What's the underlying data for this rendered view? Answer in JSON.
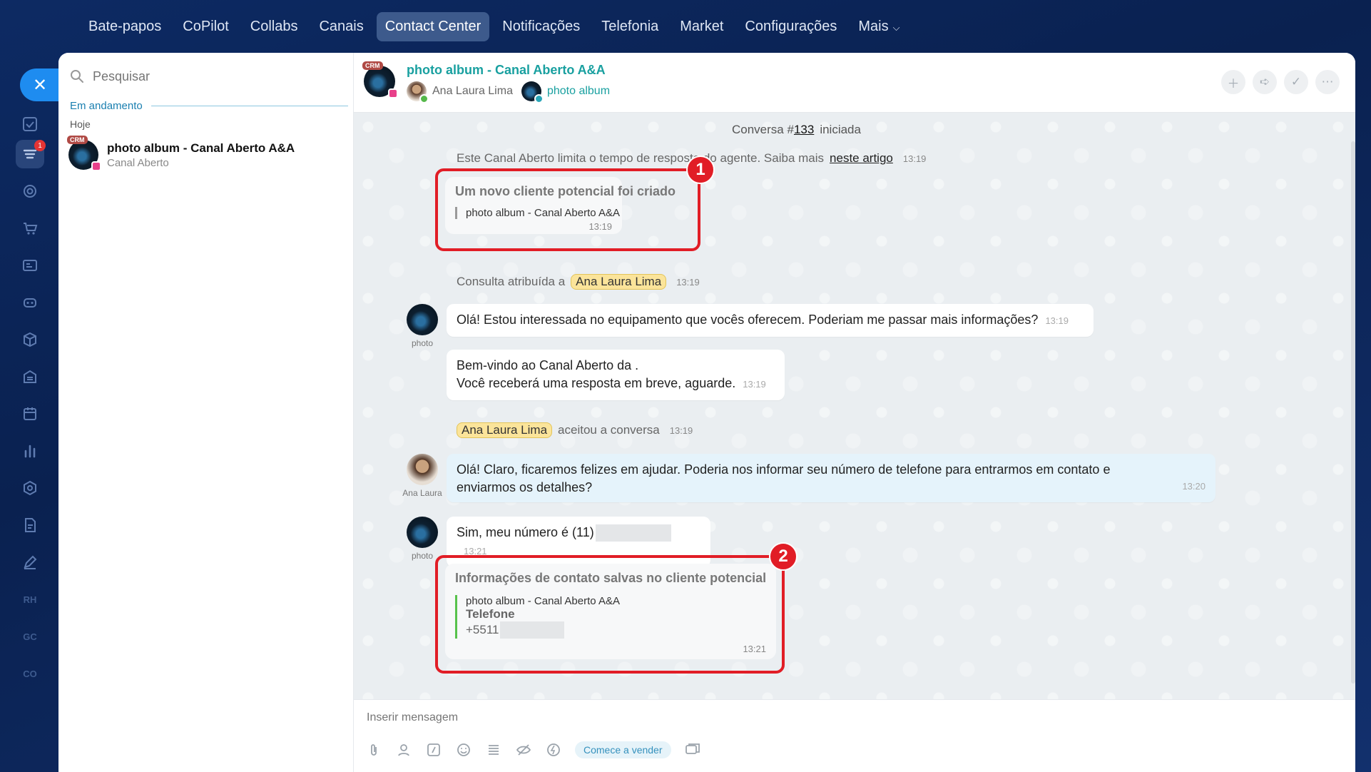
{
  "topnav": {
    "items": [
      "Bate-papos",
      "CoPilot",
      "Collabs",
      "Canais",
      "Contact Center",
      "Notificações",
      "Telefonia",
      "Market",
      "Configurações",
      "Mais"
    ],
    "active_index": 4
  },
  "rail": {
    "close_glyph": "✕",
    "badge": "1",
    "text_items": [
      "RH",
      "GC",
      "CO"
    ]
  },
  "sidebar": {
    "search_placeholder": "Pesquisar",
    "section_title": "Em andamento",
    "day_label": "Hoje",
    "chat": {
      "title": "photo album - Canal Aberto A&A",
      "subtitle": "Canal Aberto",
      "crm_tag": "CRM"
    }
  },
  "header": {
    "title": "photo album - Canal Aberto A&A",
    "crm_tag": "CRM",
    "user_name": "Ana Laura Lima",
    "channel_name": "photo album",
    "actions": [
      "add-icon",
      "forward-icon",
      "check-circle-icon",
      "more-icon"
    ]
  },
  "messages": {
    "conversation_start_prefix": "Conversa #",
    "conversation_number": "133",
    "conversation_start_suffix": "iniciada",
    "limit_notice_text": "Este Canal Aberto limita o tempo de resposta do agente. Saiba mais",
    "limit_notice_link": "neste artigo",
    "limit_notice_time": "13:19",
    "lead_card": {
      "title": "Um novo cliente potencial foi criado",
      "quote": "photo album - Canal Aberto A&A",
      "time": "13:19"
    },
    "assigned_text": "Consulta atribuída a",
    "assigned_name": "Ana Laura Lima",
    "assigned_time": "13:19",
    "client_msg_1": {
      "sender": "photo",
      "text": "Olá! Estou interessada no equipamento que vocês oferecem. Poderiam me passar mais informações?",
      "time": "13:19"
    },
    "welcome_msg": {
      "line1": "Bem-vindo ao Canal Aberto da .",
      "line2": "Você receberá uma resposta em breve, aguarde.",
      "time": "13:19"
    },
    "accepted_name": "Ana Laura Lima",
    "accepted_text": "aceitou a conversa",
    "accepted_time": "13:19",
    "operator_msg": {
      "sender": "Ana Laura",
      "text": "Olá! Claro, ficaremos felizes em ajudar. Poderia nos informar seu número de telefone para entrarmos em contato e enviarmos os detalhes?",
      "time": "13:20"
    },
    "client_msg_2": {
      "sender": "photo",
      "text": "Sim, meu número é (11)",
      "time": "13:21"
    },
    "contact_card": {
      "title": "Informações de contato salvas no cliente potencial",
      "quote_title": "photo album - Canal Aberto A&A",
      "field_label": "Telefone",
      "field_value": "+5511",
      "time": "13:21"
    },
    "callouts": [
      "1",
      "2"
    ]
  },
  "composer": {
    "placeholder": "Inserir mensagem",
    "sell_button": "Comece a vender",
    "tools": [
      "attach-icon",
      "contact-icon",
      "command-icon",
      "emoji-icon",
      "template-icon",
      "hidden-icon",
      "quick-icon",
      "copy-icon"
    ]
  },
  "colors": {
    "accent": "#1e8cf0",
    "teal_link": "#19a0a0",
    "callout_red": "#e11d26",
    "highlight": "#fbe49a"
  }
}
